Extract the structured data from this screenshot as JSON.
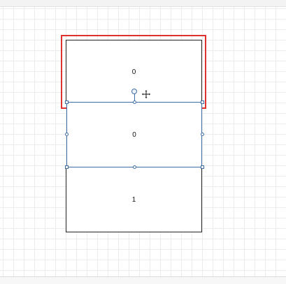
{
  "diagram": {
    "cells": [
      {
        "id": "top",
        "label": "0"
      },
      {
        "id": "middle",
        "label": "0"
      },
      {
        "id": "bottom",
        "label": "1"
      }
    ],
    "selection_color": "#3e6da6",
    "highlight_color": "#e03131",
    "cursor_icon": "move-cursor-icon"
  }
}
